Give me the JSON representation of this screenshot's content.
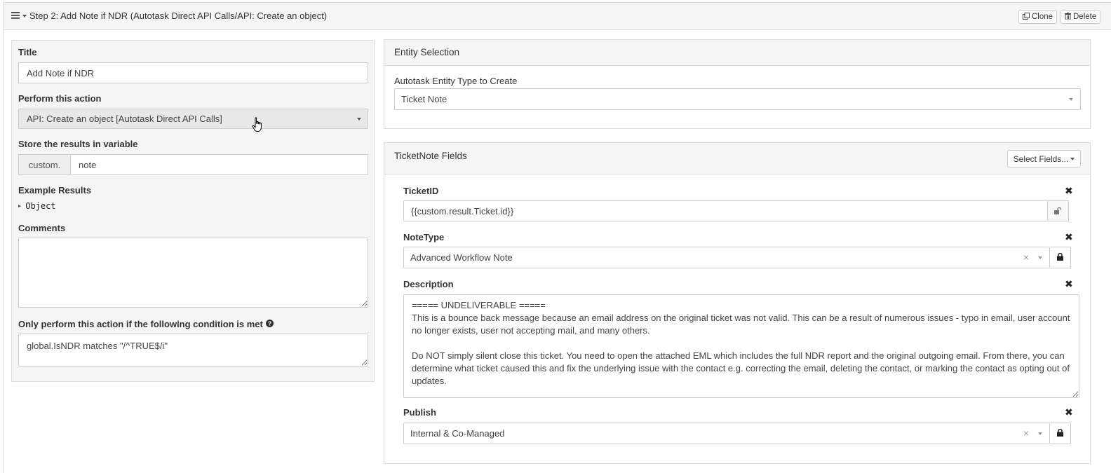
{
  "header": {
    "title": "Step 2: Add Note if NDR (Autotask Direct API Calls/API: Create an object)",
    "clone_label": "Clone",
    "delete_label": "Delete"
  },
  "left": {
    "title_label": "Title",
    "title_value": "Add Note if NDR",
    "action_label": "Perform this action",
    "action_value": "API: Create an object [Autotask Direct API Calls]",
    "store_label": "Store the results in variable",
    "store_prefix": "custom.",
    "store_value": "note",
    "example_label": "Example Results",
    "example_value": "Object",
    "comments_label": "Comments",
    "comments_value": "",
    "condition_label": "Only perform this action if the following condition is met",
    "condition_value": "global.IsNDR matches \"/^TRUE$/i\""
  },
  "entity": {
    "panel_title": "Entity Selection",
    "type_label": "Autotask Entity Type to Create",
    "type_value": "Ticket Note"
  },
  "fields": {
    "panel_title": "TicketNote Fields",
    "select_fields_label": "Select Fields...",
    "ticketid_label": "TicketID",
    "ticketid_value": "{{custom.result.Ticket.id}}",
    "notetype_label": "NoteType",
    "notetype_value": "Advanced Workflow Note",
    "description_label": "Description",
    "description_value": "===== UNDELIVERABLE =====\nThis is a bounce back message because an email address on the original ticket was not valid. This can be a result of numerous issues - typo in email, user account no longer exists, user not accepting mail, and many others.\n\nDo NOT simply silent close this ticket. You need to open the attached EML which includes the full NDR report and the original outgoing email. From there, you can determine what ticket caused this and fix the underlying issue with the contact e.g. correcting the email, deleting the contact, or marking the contact as opting out of updates.",
    "publish_label": "Publish",
    "publish_value": "Internal & Co-Managed"
  },
  "icons": {
    "menu": "hamburger-icon",
    "collapse": "caret-down-icon",
    "clone": "clone-icon",
    "delete": "trash-icon",
    "help": "question-circle-icon",
    "lock": "lock-icon",
    "unlock": "unlock-icon",
    "remove": "close-icon",
    "cursor": "hand-pointer-icon"
  }
}
